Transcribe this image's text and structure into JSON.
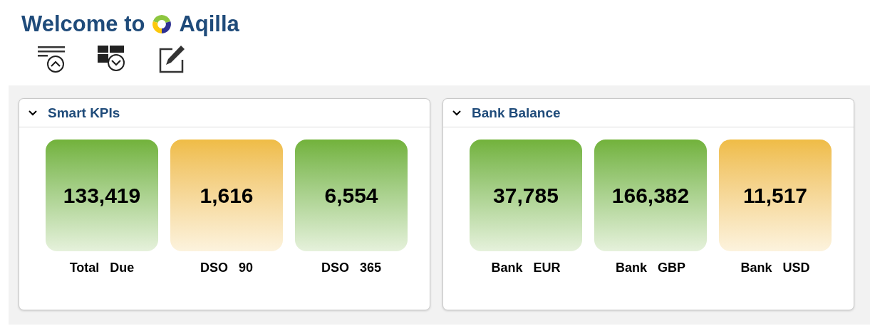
{
  "header": {
    "title_prefix": "Welcome to",
    "brand": "Aqilla"
  },
  "panels": [
    {
      "title": "Smart KPIs",
      "expanded": true,
      "tiles": [
        {
          "value": "133,419",
          "label": "Total   Due",
          "color": "#72b23a"
        },
        {
          "value": "1,616",
          "label": "DSO   90",
          "color": "#efbc45"
        },
        {
          "value": "6,554",
          "label": "DSO   365",
          "color": "#72b23a"
        }
      ]
    },
    {
      "title": "Bank Balance",
      "expanded": true,
      "tiles": [
        {
          "value": "37,785",
          "label": "Bank   EUR",
          "color": "#72b23a"
        },
        {
          "value": "166,382",
          "label": "Bank   GBP",
          "color": "#72b23a"
        },
        {
          "value": "11,517",
          "label": "Bank   USD",
          "color": "#efbc45"
        }
      ]
    }
  ]
}
